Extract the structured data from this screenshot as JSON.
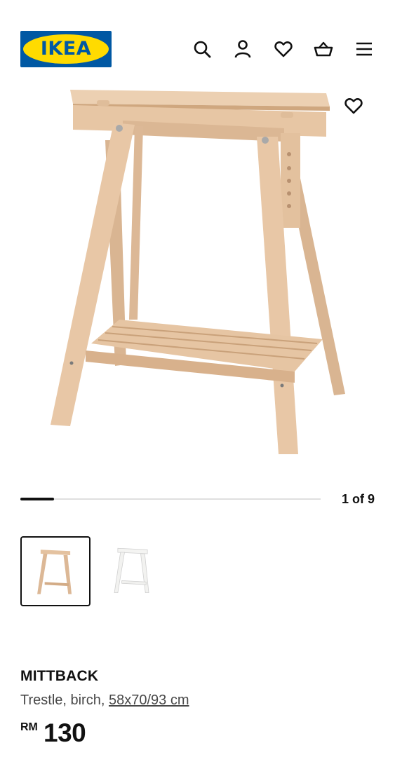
{
  "header": {
    "logo_text": "IKEA",
    "icons": [
      "search-icon",
      "user-icon",
      "heart-icon",
      "basket-icon",
      "menu-icon"
    ]
  },
  "gallery": {
    "current": 1,
    "total": 9,
    "counter_text": "1 of 9",
    "thumbnails": [
      {
        "finish": "birch",
        "selected": true
      },
      {
        "finish": "white",
        "selected": false
      }
    ]
  },
  "product": {
    "name": "MITTBACK",
    "description": "Trestle, birch, ",
    "dimensions": "58x70/93 cm",
    "currency": "RM",
    "price": "130"
  },
  "colors": {
    "ikea_blue": "#0058a3",
    "ikea_yellow": "#ffdb00",
    "birch": "#e8c7a6",
    "birch_shade": "#d6b08c"
  }
}
